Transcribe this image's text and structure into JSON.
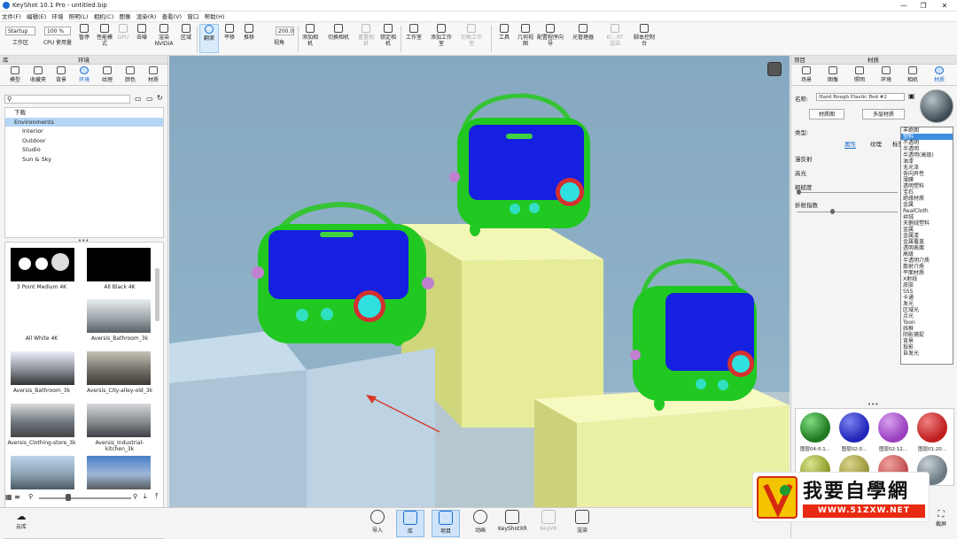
{
  "window": {
    "title": "KeyShot 10.1 Pro  - untitled.bip",
    "min": "—",
    "max": "❐",
    "close": "✕"
  },
  "menu": [
    "文件(F)",
    "编辑(E)",
    "环境",
    "照明(L)",
    "相机(C)",
    "图像",
    "渲染(R)",
    "查看(V)",
    "窗口",
    "帮助(H)"
  ],
  "toolbar": {
    "workspace_select": "Startup",
    "zoom_select": "100 %",
    "fov_value": "200.0",
    "buttons": [
      "工作区",
      "CPU 使用量",
      "暂停",
      "性能模式",
      "GPU",
      "去噪",
      "渲染 NVIDIA",
      "区域",
      "翻滚",
      "平移",
      "推移",
      "视角",
      "添加相机",
      "切换相机",
      "重置相机",
      "锁定相机",
      "工作室",
      "添加工作室",
      "切换工作室",
      "工具",
      "几何视图",
      "配置程序向导",
      "光管理器",
      "Ki...RT 渲染",
      "脚本控制台"
    ]
  },
  "left_panel": {
    "header": "库",
    "section": "环境",
    "tabs": [
      "模型",
      "收藏夹",
      "背景",
      "环境",
      "纹理",
      "颜色",
      "材质"
    ],
    "tree": [
      {
        "label": "下载",
        "indent": 0,
        "selected": false
      },
      {
        "label": "Environments",
        "indent": 0,
        "selected": true
      },
      {
        "label": "Interior",
        "indent": 1,
        "selected": false
      },
      {
        "label": "Outdoor",
        "indent": 1,
        "selected": false
      },
      {
        "label": "Studio",
        "indent": 1,
        "selected": false
      },
      {
        "label": "Sun & Sky",
        "indent": 1,
        "selected": false
      }
    ],
    "thumbnails": [
      "3 Point Medium 4K",
      "All Black 4K",
      "All White 4K",
      "Aversis_Bathroom_3k",
      "Aversis_Bathroom_3k",
      "Aversis_City-alley-old_3k",
      "Aversis_Clothing-store_3k",
      "Aversis_Industrial-kitchen_3k"
    ],
    "footer_label": "云库"
  },
  "right_panel": {
    "header_left": "项目",
    "header": "材质",
    "tabs": [
      "场景",
      "图像",
      "照明",
      "环境",
      "相机",
      "材质"
    ],
    "name_label": "名称:",
    "name_value": "Hard Rough Plastic Red #2",
    "graph_btn": "材质图",
    "multi_btn": "多层材质",
    "type_label": "类型:",
    "type_value": "塑料",
    "subtabs": [
      "属性",
      "纹理",
      "标签"
    ],
    "props": [
      "漫反射",
      "高光",
      "粗糙度",
      "折射指数"
    ],
    "dropdown": [
      "丰绝图",
      "塑料",
      "不透明",
      "半透明",
      "半透明(高级)",
      "油漆",
      "无光泽",
      "各向异性",
      "薄膜",
      "透明塑料",
      "宝石",
      "绝缘材质",
      "金属",
      "RealCloth",
      "丝绒",
      "天鹅绒塑料",
      "金属",
      "金属漆",
      "金属覆盖",
      "透明表面",
      "高级",
      "半透明介质",
      "散射介质",
      "平面材质",
      "X射线",
      "皮肤",
      "SSS",
      "卡通",
      "发光",
      "区域光",
      "点光",
      "Toon",
      "线框",
      "阴影捕捉",
      "背景",
      "投影",
      "自发光"
    ],
    "swatches": [
      {
        "label": "图层04:0:1...",
        "color": "#1f7a1f"
      },
      {
        "label": "图层02:0...",
        "color": "#2026b8"
      },
      {
        "label": "图层02:12...",
        "color": "#9a40c0"
      },
      {
        "label": "图层01:20...",
        "color": "#c02020"
      }
    ],
    "footer": "截屏"
  },
  "bottom_bar": [
    "导入",
    "库",
    "项目",
    "动画",
    "KeyShotXR",
    "KeyVR",
    "渲染"
  ],
  "watermark": {
    "title": "我要自學網",
    "url": "WWW.51ZXW.NET"
  },
  "colors": {
    "accent": "#1a6ad1",
    "radio_green": "#22d022",
    "screen_blue": "#1620e0",
    "handle_green": "#30c030"
  }
}
